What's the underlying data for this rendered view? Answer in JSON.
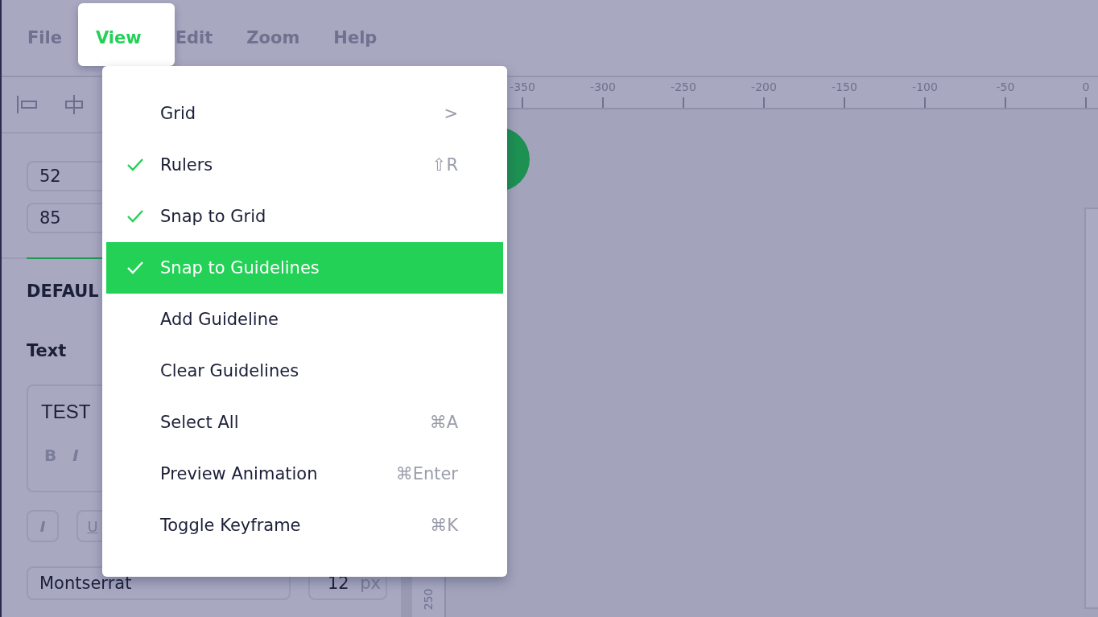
{
  "menu_bar": [
    {
      "label": "File",
      "selected": false
    },
    {
      "label": "View",
      "selected": true
    },
    {
      "label": "Edit",
      "selected": false
    },
    {
      "label": "Zoom",
      "selected": false
    },
    {
      "label": "Help",
      "selected": false
    }
  ],
  "view_menu": [
    {
      "label": "Grid",
      "checked": false,
      "selected": false,
      "shortcut": ">"
    },
    {
      "label": "Rulers",
      "checked": true,
      "selected": false,
      "shortcut": "⇧R"
    },
    {
      "label": "Snap to Grid",
      "checked": true,
      "selected": false
    },
    {
      "label": "Snap to Guidelines",
      "checked": true,
      "selected": true
    },
    {
      "label": "Add Guideline",
      "checked": false,
      "selected": false
    },
    {
      "label": "Clear Guidelines",
      "checked": false,
      "selected": false
    },
    {
      "label": "Select All",
      "checked": false,
      "selected": false,
      "shortcut": "⌘A"
    },
    {
      "label": "Preview Animation",
      "checked": false,
      "selected": false,
      "shortcut": "⌘Enter"
    },
    {
      "label": "Toggle Keyframe",
      "checked": false,
      "selected": false,
      "shortcut": "⌘K"
    }
  ],
  "panel": {
    "fields": [
      "52",
      "85"
    ],
    "section_heading": "DEFAUL",
    "text_label": "Text",
    "text_value": "TEST",
    "inline_format": [
      "B",
      "I"
    ],
    "style_buttons": [
      "I",
      "U"
    ],
    "font": "Montserrat",
    "font_size": "12",
    "font_size_unit": "px"
  },
  "ruler": {
    "top_labels": [
      "-350",
      "-300",
      "-250",
      "-200",
      "-150",
      "-100",
      "-50",
      "0"
    ],
    "side_labels": [
      "250"
    ]
  }
}
